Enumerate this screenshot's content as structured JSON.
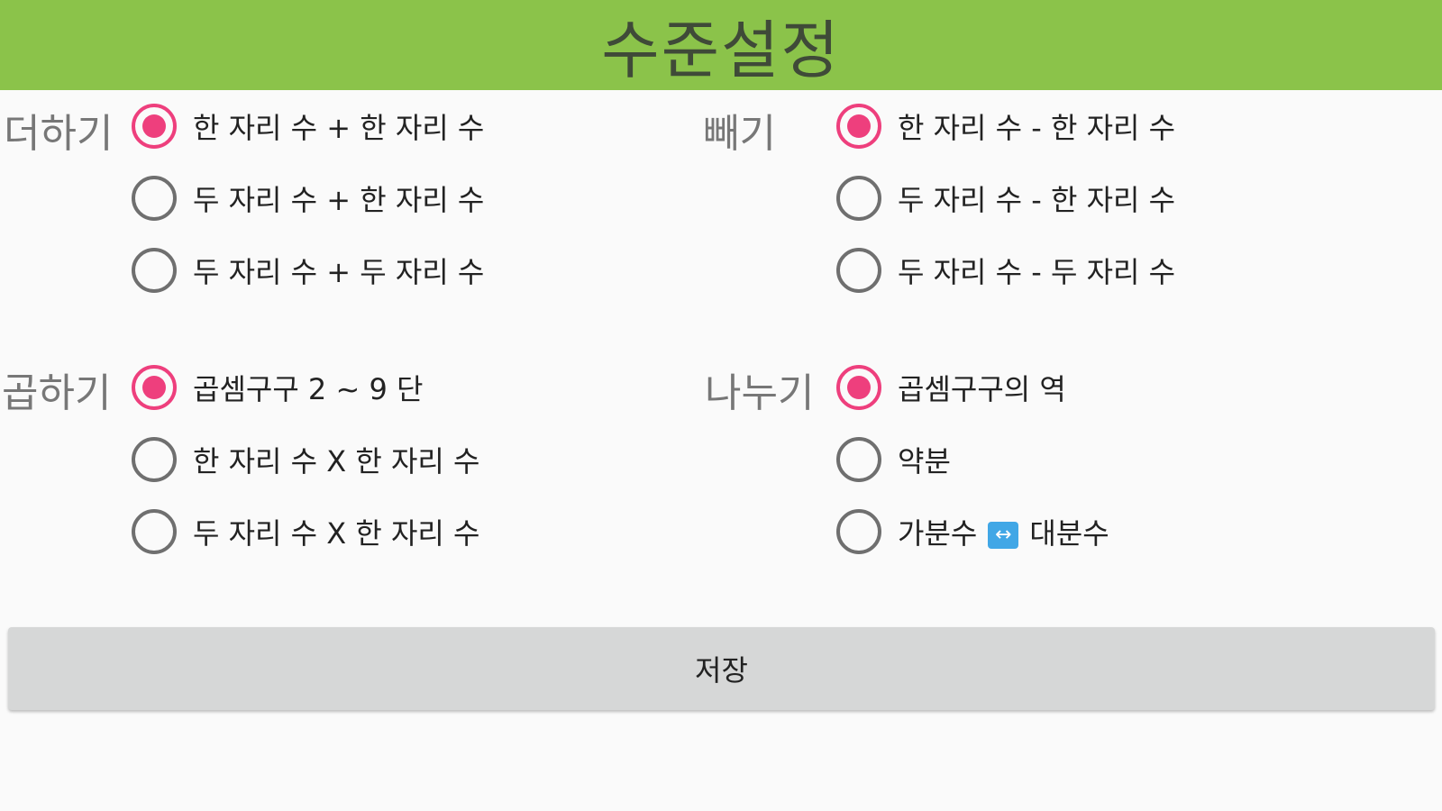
{
  "header": {
    "title": "수준설정"
  },
  "groups": {
    "add": {
      "label": "더하기",
      "options": [
        {
          "label": "한 자리 수 + 한 자리 수",
          "checked": true
        },
        {
          "label": "두 자리 수 + 한 자리 수",
          "checked": false
        },
        {
          "label": "두 자리 수 + 두 자리 수",
          "checked": false
        }
      ]
    },
    "subtract": {
      "label": "빼기",
      "options": [
        {
          "label": "한 자리 수 - 한 자리 수",
          "checked": true
        },
        {
          "label": "두 자리 수 - 한 자리 수",
          "checked": false
        },
        {
          "label": "두 자리 수 - 두 자리 수",
          "checked": false
        }
      ]
    },
    "multiply": {
      "label": "곱하기",
      "options": [
        {
          "label": "곱셈구구 2 ~ 9 단",
          "checked": true
        },
        {
          "label": "한 자리 수 X 한 자리 수",
          "checked": false
        },
        {
          "label": "두 자리 수 X 한 자리 수",
          "checked": false
        }
      ]
    },
    "divide": {
      "label": "나누기",
      "options": [
        {
          "label": "곱셈구구의 역",
          "checked": true
        },
        {
          "label": "약분",
          "checked": false
        },
        {
          "label_left": "가분수",
          "icon": "left-right-arrow-icon",
          "icon_glyph": "↔",
          "label_right": "대분수",
          "checked": false
        }
      ]
    }
  },
  "save_button": {
    "label": "저장"
  },
  "colors": {
    "header_bg": "#8bc34a",
    "accent": "#ee3f7d",
    "button_bg": "#d6d7d7",
    "background": "#fafafa"
  }
}
